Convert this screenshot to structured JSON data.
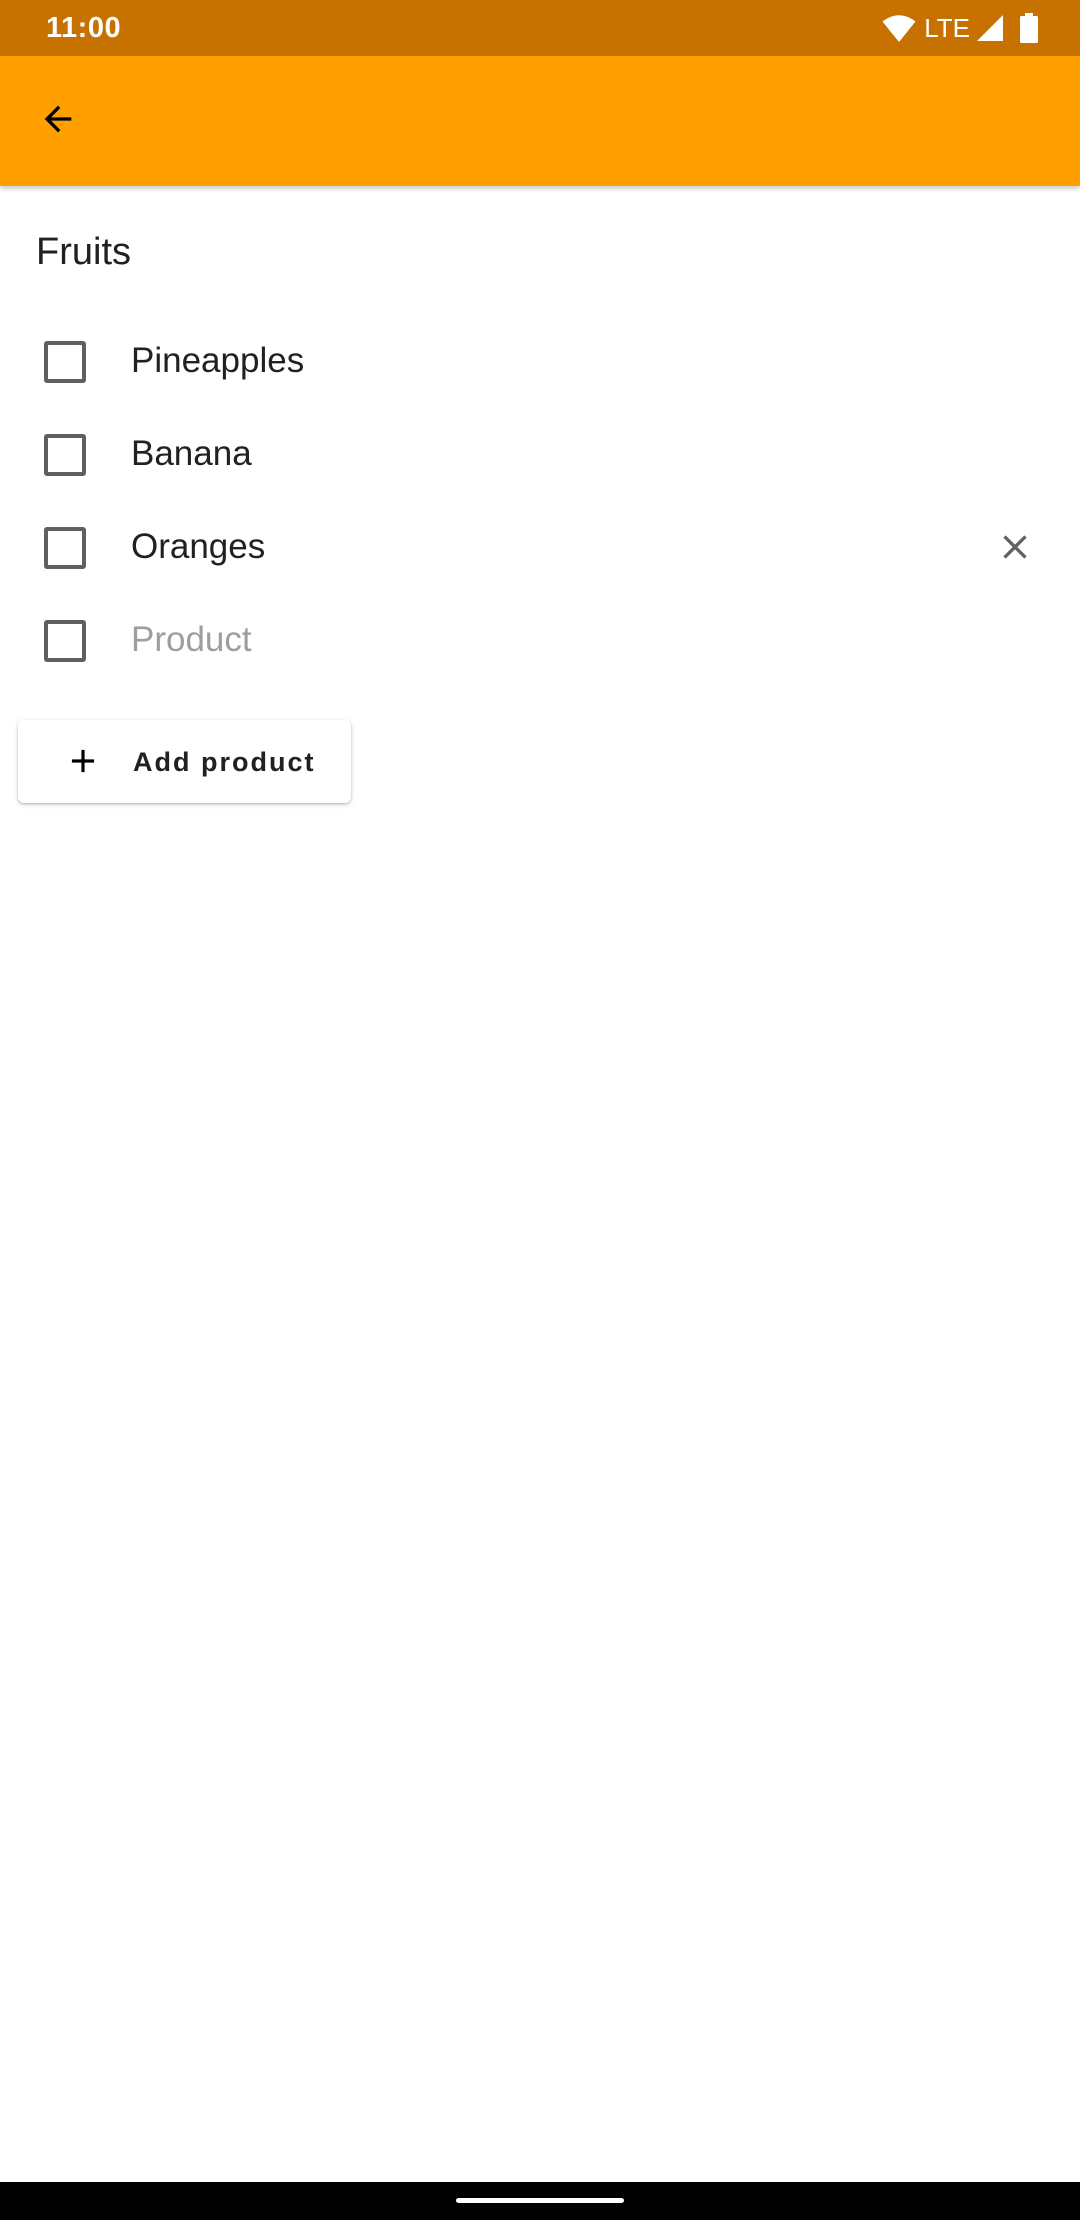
{
  "status_bar": {
    "time": "11:00",
    "network": "LTE",
    "icons": [
      "wifi-icon",
      "cell-signal-icon",
      "battery-icon"
    ],
    "background": "#c67100"
  },
  "app_bar": {
    "background": "#ffa000",
    "back_icon": "arrow-back-icon"
  },
  "list": {
    "name": "Fruits",
    "items": [
      {
        "label": "Pineapples",
        "checked": false
      },
      {
        "label": "Banana",
        "checked": false
      },
      {
        "label": "Oranges",
        "checked": false,
        "remove_icon": "close-icon"
      }
    ],
    "new_item": {
      "value": "",
      "placeholder": "Product",
      "checked": false
    },
    "add_button": {
      "label": "Add product",
      "icon": "plus-icon"
    }
  }
}
